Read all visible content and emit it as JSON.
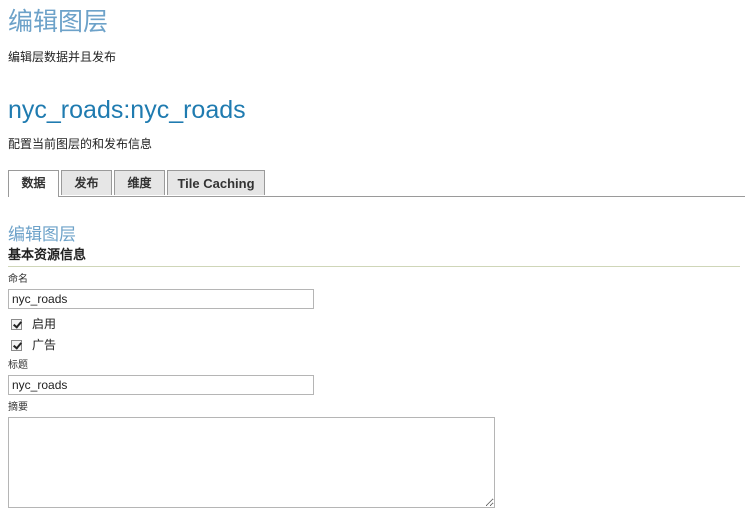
{
  "page": {
    "title": "编辑图层",
    "description": "编辑层数据并且发布"
  },
  "layer": {
    "name": "nyc_roads:nyc_roads",
    "description": "配置当前图层的和发布信息"
  },
  "tabs": [
    {
      "label": "数据",
      "active": true
    },
    {
      "label": "发布",
      "active": false
    },
    {
      "label": "维度",
      "active": false
    },
    {
      "label": "Tile Caching",
      "active": false
    }
  ],
  "section": {
    "title": "编辑图层",
    "subtitle": "基本资源信息"
  },
  "form": {
    "name_label": "命名",
    "name_value": "nyc_roads",
    "enabled_label": "启用",
    "enabled_checked": true,
    "advertised_label": "广告",
    "advertised_checked": true,
    "title_label": "标题",
    "title_value": "nyc_roads",
    "abstract_label": "摘要",
    "abstract_value": ""
  }
}
